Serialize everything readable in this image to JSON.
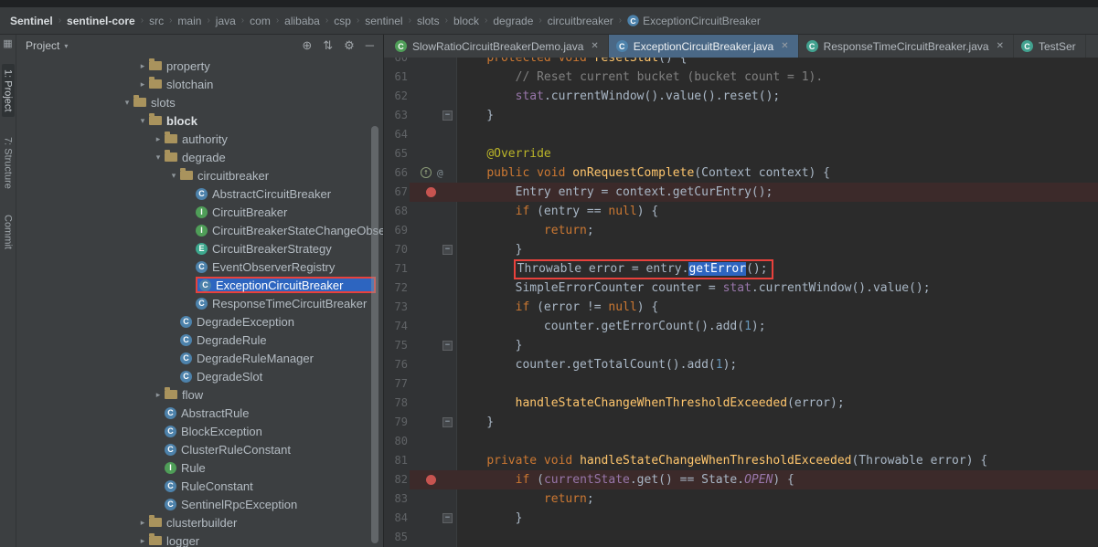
{
  "colors": {
    "selection_blue": "#2d65c0",
    "breakpoint_line": "#3c2a2a",
    "annotation_red": "#e8413c",
    "active_tab": "#4a6886"
  },
  "breadcrumb": {
    "items": [
      {
        "label": "Sentinel",
        "bold": true
      },
      {
        "label": "sentinel-core",
        "bold": true
      },
      {
        "label": "src"
      },
      {
        "label": "main"
      },
      {
        "label": "java"
      },
      {
        "label": "com"
      },
      {
        "label": "alibaba"
      },
      {
        "label": "csp"
      },
      {
        "label": "sentinel"
      },
      {
        "label": "slots"
      },
      {
        "label": "block"
      },
      {
        "label": "degrade"
      },
      {
        "label": "circuitbreaker"
      },
      {
        "label": "ExceptionCircuitBreaker",
        "icon": "class"
      }
    ]
  },
  "left_stripe": {
    "top_icon": "▦",
    "buttons": [
      {
        "label": "1: Project",
        "active": true
      },
      {
        "label": "7: Structure",
        "active": false
      },
      {
        "label": "Commit",
        "active": false
      }
    ]
  },
  "project_panel": {
    "title": "Project",
    "caret": "▾",
    "header_icons": [
      {
        "name": "locate",
        "glyph": "⊕"
      },
      {
        "name": "collapse-all",
        "glyph": "⇅"
      },
      {
        "name": "settings-gear",
        "glyph": "⚙"
      },
      {
        "name": "hide-panel",
        "glyph": "─"
      }
    ],
    "tree": [
      {
        "label": "property",
        "icon": "folder",
        "level": 1,
        "arrow": "right"
      },
      {
        "label": "slotchain",
        "icon": "folder",
        "level": 1,
        "arrow": "right"
      },
      {
        "label": "slots",
        "icon": "folder",
        "level": 0,
        "arrow": "down"
      },
      {
        "label": "block",
        "icon": "folder",
        "level": 1,
        "arrow": "down",
        "bold": true
      },
      {
        "label": "authority",
        "icon": "folder",
        "level": 2,
        "arrow": "right"
      },
      {
        "label": "degrade",
        "icon": "folder",
        "level": 2,
        "arrow": "down"
      },
      {
        "label": "circuitbreaker",
        "icon": "folder",
        "level": 3,
        "arrow": "down"
      },
      {
        "label": "AbstractCircuitBreaker",
        "icon": "class",
        "level": 4
      },
      {
        "label": "CircuitBreaker",
        "icon": "interface",
        "level": 4
      },
      {
        "label": "CircuitBreakerStateChangeObse",
        "icon": "interface",
        "level": 4
      },
      {
        "label": "CircuitBreakerStrategy",
        "icon": "enum",
        "level": 4
      },
      {
        "label": "EventObserverRegistry",
        "icon": "class",
        "level": 4
      },
      {
        "label": "ExceptionCircuitBreaker",
        "icon": "class",
        "level": 4,
        "selected": true,
        "boxed": true
      },
      {
        "label": "ResponseTimeCircuitBreaker",
        "icon": "class",
        "level": 4
      },
      {
        "label": "DegradeException",
        "icon": "class",
        "level": 3
      },
      {
        "label": "DegradeRule",
        "icon": "class",
        "level": 3
      },
      {
        "label": "DegradeRuleManager",
        "icon": "class",
        "level": 3
      },
      {
        "label": "DegradeSlot",
        "icon": "class",
        "level": 3
      },
      {
        "label": "flow",
        "icon": "folder",
        "level": 2,
        "arrow": "right"
      },
      {
        "label": "AbstractRule",
        "icon": "class",
        "level": 2
      },
      {
        "label": "BlockException",
        "icon": "class",
        "level": 2
      },
      {
        "label": "ClusterRuleConstant",
        "icon": "class",
        "level": 2
      },
      {
        "label": "Rule",
        "icon": "interface",
        "level": 2
      },
      {
        "label": "RuleConstant",
        "icon": "class",
        "level": 2
      },
      {
        "label": "SentinelRpcException",
        "icon": "class",
        "level": 2
      },
      {
        "label": "clusterbuilder",
        "icon": "folder",
        "level": 1,
        "arrow": "right"
      },
      {
        "label": "logger",
        "icon": "folder",
        "level": 1,
        "arrow": "right"
      }
    ]
  },
  "tabs": [
    {
      "label": "SlowRatioCircuitBreakerDemo.java",
      "icon_color": "#4f9e58",
      "close": true,
      "active": false
    },
    {
      "label": "ExceptionCircuitBreaker.java",
      "icon_color": "#4d82ab",
      "close": true,
      "active": true
    },
    {
      "label": "ResponseTimeCircuitBreaker.java",
      "icon_color": "#42a18f",
      "close": true,
      "active": false
    },
    {
      "label": "TestSer",
      "icon_color": "#42a18f",
      "close": false,
      "active": false
    }
  ],
  "editor": {
    "lines": [
      {
        "num": 60,
        "tokens": [
          {
            "t": "    "
          },
          {
            "t": "protected void ",
            "c": "kw"
          },
          {
            "t": "resetStat",
            "c": "md"
          },
          {
            "t": "() {"
          }
        ]
      },
      {
        "num": 61,
        "tokens": [
          {
            "t": "        "
          },
          {
            "t": "// Reset current bucket (bucket count = 1).",
            "c": "cm"
          }
        ]
      },
      {
        "num": 62,
        "tokens": [
          {
            "t": "        "
          },
          {
            "t": "stat",
            "c": "fl"
          },
          {
            "t": ".currentWindow().value().reset();"
          }
        ]
      },
      {
        "num": 63,
        "fold": true,
        "tokens": [
          {
            "t": "    }"
          }
        ]
      },
      {
        "num": 64,
        "tokens": []
      },
      {
        "num": 65,
        "tokens": [
          {
            "t": "    "
          },
          {
            "t": "@Override",
            "c": "an"
          }
        ]
      },
      {
        "num": 66,
        "gutter": "override",
        "tokens": [
          {
            "t": "    "
          },
          {
            "t": "public void ",
            "c": "kw"
          },
          {
            "t": "onRequestComplete",
            "c": "md"
          },
          {
            "t": "(Context context) {"
          }
        ]
      },
      {
        "num": 67,
        "bp": true,
        "tokens": [
          {
            "t": "        Entry entry = context.getCurEntry();"
          }
        ]
      },
      {
        "num": 68,
        "tokens": [
          {
            "t": "        "
          },
          {
            "t": "if",
            "c": "kw"
          },
          {
            "t": " (entry == "
          },
          {
            "t": "null",
            "c": "kw"
          },
          {
            "t": ") {"
          }
        ]
      },
      {
        "num": 69,
        "tokens": [
          {
            "t": "            "
          },
          {
            "t": "return",
            "c": "kw"
          },
          {
            "t": ";"
          }
        ]
      },
      {
        "num": 70,
        "fold": true,
        "tokens": [
          {
            "t": "        }"
          }
        ]
      },
      {
        "num": 71,
        "boxed": true,
        "tokens": [
          {
            "t": "        "
          },
          {
            "t": "Throwable error = entry."
          },
          {
            "t": "getError",
            "c": "sel"
          },
          {
            "t": "();"
          }
        ]
      },
      {
        "num": 72,
        "tokens": [
          {
            "t": "        SimpleErrorCounter counter = "
          },
          {
            "t": "stat",
            "c": "fl"
          },
          {
            "t": ".currentWindow().value();"
          }
        ]
      },
      {
        "num": 73,
        "tokens": [
          {
            "t": "        "
          },
          {
            "t": "if",
            "c": "kw"
          },
          {
            "t": " (error != "
          },
          {
            "t": "null",
            "c": "kw"
          },
          {
            "t": ") {"
          }
        ]
      },
      {
        "num": 74,
        "tokens": [
          {
            "t": "            counter.getErrorCount().add("
          },
          {
            "t": "1",
            "c": "nm"
          },
          {
            "t": ");"
          }
        ]
      },
      {
        "num": 75,
        "fold": true,
        "tokens": [
          {
            "t": "        }"
          }
        ]
      },
      {
        "num": 76,
        "tokens": [
          {
            "t": "        counter.getTotalCount().add("
          },
          {
            "t": "1",
            "c": "nm"
          },
          {
            "t": ");"
          }
        ]
      },
      {
        "num": 77,
        "tokens": []
      },
      {
        "num": 78,
        "tokens": [
          {
            "t": "        "
          },
          {
            "t": "handleStateChangeWhenThresholdExceeded",
            "c": "md"
          },
          {
            "t": "(error);"
          }
        ]
      },
      {
        "num": 79,
        "fold": true,
        "tokens": [
          {
            "t": "    }"
          }
        ]
      },
      {
        "num": 80,
        "tokens": []
      },
      {
        "num": 81,
        "tokens": [
          {
            "t": "    "
          },
          {
            "t": "private void ",
            "c": "kw"
          },
          {
            "t": "handleStateChangeWhenThresholdExceeded",
            "c": "md"
          },
          {
            "t": "(Throwable error) {"
          }
        ]
      },
      {
        "num": 82,
        "bp": true,
        "tokens": [
          {
            "t": "        "
          },
          {
            "t": "if",
            "c": "kw"
          },
          {
            "t": " ("
          },
          {
            "t": "currentState",
            "c": "fl"
          },
          {
            "t": ".get() == State."
          },
          {
            "t": "OPEN",
            "c": "cn"
          },
          {
            "t": ") {"
          }
        ]
      },
      {
        "num": 83,
        "tokens": [
          {
            "t": "            "
          },
          {
            "t": "return",
            "c": "kw"
          },
          {
            "t": ";"
          }
        ]
      },
      {
        "num": 84,
        "fold": true,
        "tokens": [
          {
            "t": "        }"
          }
        ]
      },
      {
        "num": 85,
        "tokens": []
      }
    ]
  }
}
